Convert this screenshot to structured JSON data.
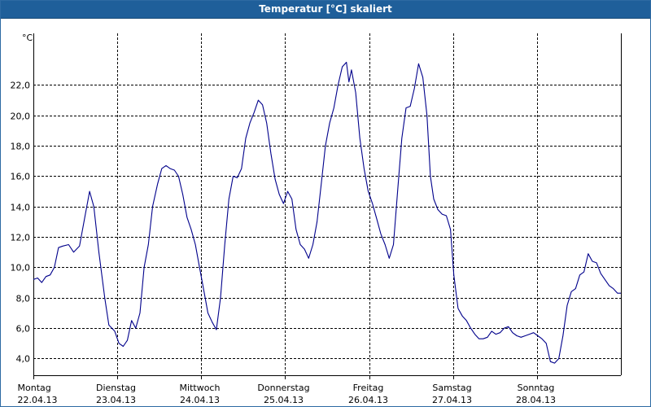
{
  "window": {
    "title": "Temperatur [°C] skaliert"
  },
  "chart_data": {
    "type": "line",
    "title": "Temperatur [°C] skaliert",
    "ylabel": "°C",
    "xlabel": "",
    "ylim": [
      2.9,
      25.4
    ],
    "xlim": [
      0,
      7
    ],
    "grid": true,
    "yticks": [
      4.0,
      6.0,
      8.0,
      10.0,
      12.0,
      14.0,
      16.0,
      18.0,
      20.0,
      22.0
    ],
    "ytick_labels": [
      "4,0",
      "6,0",
      "8,0",
      "10,0",
      "12,0",
      "14,0",
      "16,0",
      "18,0",
      "20,0",
      "22,0"
    ],
    "xticks": [
      {
        "x": 0,
        "day": "Montag",
        "date": "22.04.13"
      },
      {
        "x": 1,
        "day": "Dienstag",
        "date": "23.04.13"
      },
      {
        "x": 2,
        "day": "Mittwoch",
        "date": "24.04.13"
      },
      {
        "x": 3,
        "day": "Donnerstag",
        "date": "25.04.13"
      },
      {
        "x": 4,
        "day": "Freitag",
        "date": "26.04.13"
      },
      {
        "x": 5,
        "day": "Samstag",
        "date": "27.04.13"
      },
      {
        "x": 6,
        "day": "Sonntag",
        "date": "28.04.13"
      }
    ],
    "series": [
      {
        "color": "#00008b",
        "points": [
          [
            0.0,
            9.2
          ],
          [
            0.05,
            9.3
          ],
          [
            0.1,
            9.0
          ],
          [
            0.15,
            9.4
          ],
          [
            0.2,
            9.5
          ],
          [
            0.25,
            10.0
          ],
          [
            0.3,
            11.3
          ],
          [
            0.35,
            11.4
          ],
          [
            0.42,
            11.5
          ],
          [
            0.48,
            11.0
          ],
          [
            0.55,
            11.4
          ],
          [
            0.62,
            13.5
          ],
          [
            0.67,
            15.0
          ],
          [
            0.72,
            14.0
          ],
          [
            0.78,
            11.0
          ],
          [
            0.85,
            8.0
          ],
          [
            0.9,
            6.2
          ],
          [
            0.97,
            5.8
          ],
          [
            1.02,
            5.0
          ],
          [
            1.07,
            4.8
          ],
          [
            1.12,
            5.2
          ],
          [
            1.17,
            6.5
          ],
          [
            1.22,
            6.0
          ],
          [
            1.27,
            7.0
          ],
          [
            1.32,
            10.0
          ],
          [
            1.37,
            11.5
          ],
          [
            1.42,
            14.0
          ],
          [
            1.48,
            15.5
          ],
          [
            1.53,
            16.5
          ],
          [
            1.58,
            16.7
          ],
          [
            1.63,
            16.5
          ],
          [
            1.68,
            16.4
          ],
          [
            1.73,
            16.0
          ],
          [
            1.78,
            14.8
          ],
          [
            1.83,
            13.3
          ],
          [
            1.88,
            12.5
          ],
          [
            1.93,
            11.5
          ],
          [
            1.98,
            10.0
          ],
          [
            2.03,
            8.5
          ],
          [
            2.08,
            7.0
          ],
          [
            2.13,
            6.4
          ],
          [
            2.18,
            5.9
          ],
          [
            2.23,
            8.0
          ],
          [
            2.28,
            11.5
          ],
          [
            2.33,
            14.5
          ],
          [
            2.38,
            16.0
          ],
          [
            2.43,
            15.9
          ],
          [
            2.48,
            16.5
          ],
          [
            2.53,
            18.5
          ],
          [
            2.58,
            19.5
          ],
          [
            2.63,
            20.2
          ],
          [
            2.68,
            21.0
          ],
          [
            2.73,
            20.7
          ],
          [
            2.78,
            19.5
          ],
          [
            2.83,
            17.5
          ],
          [
            2.88,
            15.8
          ],
          [
            2.93,
            14.8
          ],
          [
            2.98,
            14.2
          ],
          [
            3.03,
            15.0
          ],
          [
            3.08,
            14.5
          ],
          [
            3.13,
            12.5
          ],
          [
            3.18,
            11.5
          ],
          [
            3.23,
            11.2
          ],
          [
            3.28,
            10.6
          ],
          [
            3.33,
            11.5
          ],
          [
            3.38,
            13.0
          ],
          [
            3.43,
            15.5
          ],
          [
            3.48,
            18.0
          ],
          [
            3.53,
            19.5
          ],
          [
            3.58,
            20.5
          ],
          [
            3.63,
            22.0
          ],
          [
            3.68,
            23.2
          ],
          [
            3.73,
            23.5
          ],
          [
            3.76,
            22.2
          ],
          [
            3.79,
            23.0
          ],
          [
            3.84,
            21.5
          ],
          [
            3.89,
            18.5
          ],
          [
            3.94,
            16.5
          ],
          [
            3.99,
            15.0
          ],
          [
            4.04,
            14.2
          ],
          [
            4.09,
            13.2
          ],
          [
            4.14,
            12.2
          ],
          [
            4.19,
            11.5
          ],
          [
            4.24,
            10.6
          ],
          [
            4.29,
            11.5
          ],
          [
            4.34,
            15.0
          ],
          [
            4.39,
            18.5
          ],
          [
            4.44,
            20.5
          ],
          [
            4.49,
            20.6
          ],
          [
            4.54,
            21.8
          ],
          [
            4.59,
            23.4
          ],
          [
            4.64,
            22.5
          ],
          [
            4.69,
            20.0
          ],
          [
            4.73,
            16.0
          ],
          [
            4.77,
            14.5
          ],
          [
            4.82,
            13.8
          ],
          [
            4.87,
            13.5
          ],
          [
            4.92,
            13.4
          ],
          [
            4.97,
            12.5
          ],
          [
            5.01,
            9.5
          ],
          [
            5.06,
            7.3
          ],
          [
            5.11,
            6.8
          ],
          [
            5.16,
            6.5
          ],
          [
            5.21,
            6.0
          ],
          [
            5.26,
            5.6
          ],
          [
            5.31,
            5.3
          ],
          [
            5.36,
            5.3
          ],
          [
            5.41,
            5.4
          ],
          [
            5.46,
            5.8
          ],
          [
            5.51,
            5.6
          ],
          [
            5.56,
            5.7
          ],
          [
            5.61,
            6.0
          ],
          [
            5.66,
            6.1
          ],
          [
            5.71,
            5.7
          ],
          [
            5.76,
            5.5
          ],
          [
            5.81,
            5.4
          ],
          [
            5.86,
            5.5
          ],
          [
            5.91,
            5.6
          ],
          [
            5.96,
            5.7
          ],
          [
            6.01,
            5.5
          ],
          [
            6.06,
            5.3
          ],
          [
            6.11,
            5.0
          ],
          [
            6.16,
            3.8
          ],
          [
            6.21,
            3.7
          ],
          [
            6.26,
            4.0
          ],
          [
            6.31,
            5.5
          ],
          [
            6.36,
            7.5
          ],
          [
            6.41,
            8.4
          ],
          [
            6.46,
            8.6
          ],
          [
            6.51,
            9.5
          ],
          [
            6.56,
            9.7
          ],
          [
            6.61,
            10.9
          ],
          [
            6.66,
            10.4
          ],
          [
            6.71,
            10.3
          ],
          [
            6.76,
            9.6
          ],
          [
            6.81,
            9.2
          ],
          [
            6.86,
            8.8
          ],
          [
            6.91,
            8.6
          ],
          [
            6.96,
            8.3
          ],
          [
            7.0,
            8.3
          ]
        ]
      }
    ]
  }
}
